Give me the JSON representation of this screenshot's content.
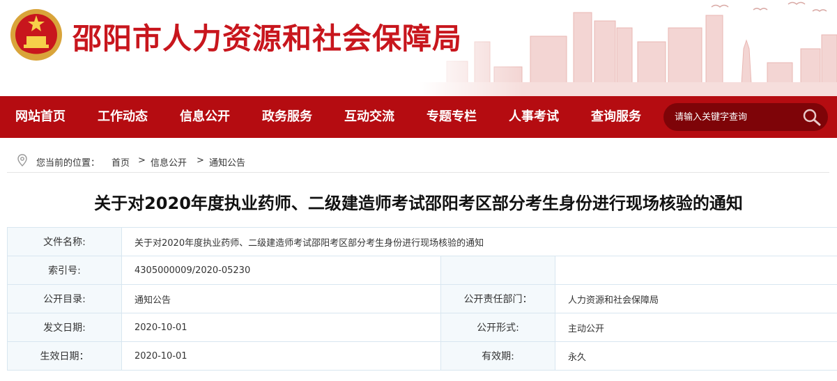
{
  "site": {
    "title": "邵阳市人力资源和社会保障局"
  },
  "nav": {
    "items": [
      "网站首页",
      "工作动态",
      "信息公开",
      "政务服务",
      "互动交流",
      "专题专栏",
      "人事考试",
      "查询服务"
    ],
    "search_placeholder": "请输入关键字查询"
  },
  "breadcrumb": {
    "prefix": "您当前的位置：",
    "items": [
      "首页",
      "信息公开",
      "通知公告"
    ],
    "separator": ">"
  },
  "article": {
    "title": "关于对2020年度执业药师、二级建造师考试邵阳考区部分考生身份进行现场核验的通知"
  },
  "meta": {
    "file_name_label": "文件名称:",
    "file_name": "关于对2020年度执业药师、二级建造师考试邵阳考区部分考生身份进行现场核验的通知",
    "index_label": "索引号:",
    "index": "4305000009/2020-05230",
    "catalog_label": "公开目录:",
    "catalog": "通知公告",
    "dept_label": "公开责任部门：",
    "dept": "人力资源和社会保障局",
    "issue_date_label": "发文日期:",
    "issue_date": "2020-10-01",
    "form_label": "公开形式:",
    "form": "主动公开",
    "effective_date_label": "生效日期：",
    "effective_date": "2020-10-01",
    "validity_label": "有效期:",
    "validity": "永久"
  },
  "colors": {
    "brand_red": "#c8161d",
    "nav_red": "#b50c11",
    "search_bg": "#7e0408"
  }
}
